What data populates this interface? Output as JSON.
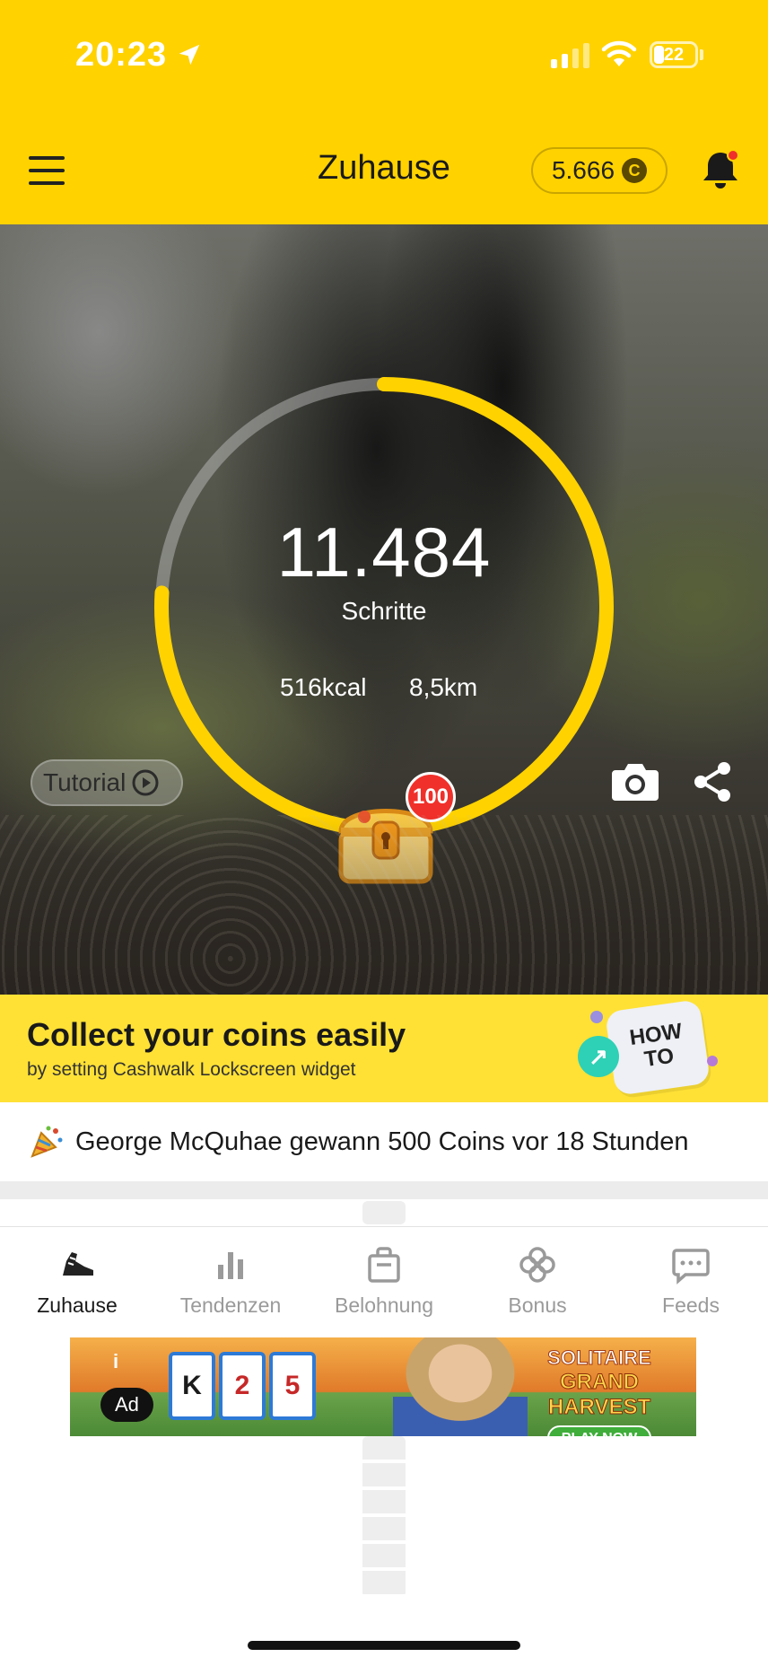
{
  "status_bar": {
    "time": "20:23",
    "battery": "22"
  },
  "header": {
    "title": "Zuhause",
    "coins": "5.666",
    "coin_symbol": "C"
  },
  "hero": {
    "steps": "11.484",
    "steps_label": "Schritte",
    "kcal": "516kcal",
    "distance": "8,5km",
    "goal_progress": 0.76,
    "chest_badge": "100",
    "tutorial_label": "Tutorial"
  },
  "promo": {
    "title": "Collect your coins easily",
    "subtitle": "by setting Cashwalk Lockscreen widget",
    "howto_line1": "HOW",
    "howto_line2": "TO"
  },
  "ticker": {
    "text": "George McQuhae gewann 500 Coins vor 18 Stunden"
  },
  "tabs": [
    {
      "label": "Zuhause",
      "icon": "shoe-icon",
      "active": true
    },
    {
      "label": "Tendenzen",
      "icon": "bar-chart-icon",
      "active": false
    },
    {
      "label": "Belohnung",
      "icon": "shopping-bag-icon",
      "active": false
    },
    {
      "label": "Bonus",
      "icon": "clover-icon",
      "active": false
    },
    {
      "label": "Feeds",
      "icon": "chat-icon",
      "active": false
    }
  ],
  "ad": {
    "badge": "Ad",
    "info": "i",
    "cards": [
      "K",
      "2",
      "5"
    ],
    "brand_line1": "SOLITAIRE",
    "brand_line2": "GRAND HARVEST",
    "cta": "PLAY NOW"
  },
  "colors": {
    "brand_yellow": "#FFD200",
    "ring_yellow": "#FFD200",
    "badge_red": "#F0302A",
    "promo_yellow": "#FFE135"
  }
}
